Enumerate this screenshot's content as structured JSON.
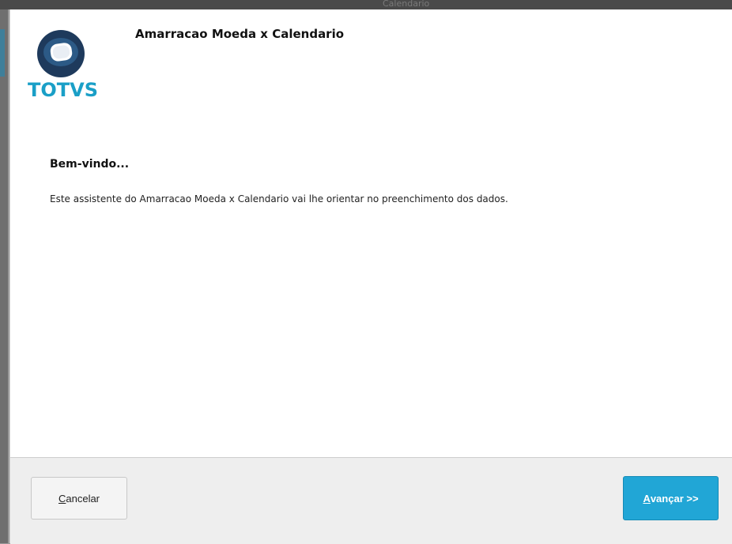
{
  "background_window": {
    "title": "Calendario"
  },
  "dialog": {
    "brand": {
      "logo_text": "TOTVS",
      "logo_color": "#1a9fc7"
    },
    "title": "Amarracao Moeda x Calendario",
    "welcome": {
      "heading": "Bem-vindo...",
      "text": "Este assistente do Amarracao Moeda x Calendario vai lhe orientar no preenchimento dos dados."
    },
    "footer": {
      "cancel_mnemonic": "C",
      "cancel_rest": "ancelar",
      "next_mnemonic": "A",
      "next_rest": "vançar >>",
      "next_color": "#21a6d6"
    }
  }
}
